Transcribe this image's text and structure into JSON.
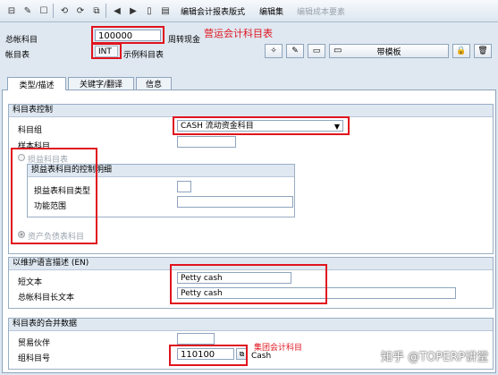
{
  "toolbar": {
    "edit_chart_layout": "编辑会计报表版式",
    "edit_set": "编辑集",
    "edit_cost_element": "编辑成本要素"
  },
  "header": {
    "gl_account_label": "总帐科目",
    "gl_account_value": "100000",
    "gl_account_desc": "周转现金",
    "chart_label": "帐目表",
    "chart_value": "INT",
    "chart_desc": "示例科目表",
    "template_button": "带模板",
    "annotation_operating": "营运会计科目表"
  },
  "tabs": [
    {
      "label": "类型/描述",
      "active": true
    },
    {
      "label": "关键字/翻译",
      "active": false
    },
    {
      "label": "信息",
      "active": false
    }
  ],
  "control": {
    "title": "科目表控制",
    "account_group_label": "科目组",
    "account_group_value": "CASH 流动资金科目",
    "sample_account_label": "样本科目",
    "pl_radio_label": "损益科目表",
    "pl_subgroup_title": "损益表科目的控制明细",
    "pl_type_label": "损益表科目类型",
    "functional_area_label": "功能范围",
    "bs_radio_label": "资产负债表科目"
  },
  "description": {
    "title": "以维护语言描述 (EN)",
    "short_text_label": "短文本",
    "short_text_value": "Petty cash",
    "long_text_label": "总帐科目长文本",
    "long_text_value": "Petty cash"
  },
  "consolidation": {
    "title": "科目表的合并数据",
    "trading_partner_label": "贸易伙伴",
    "group_account_label": "组科目号",
    "group_account_value": "110100",
    "group_account_desc": "Cash",
    "annotation_group": "集团会计科目"
  },
  "watermark": "知乎 @TOPERP讲堂"
}
